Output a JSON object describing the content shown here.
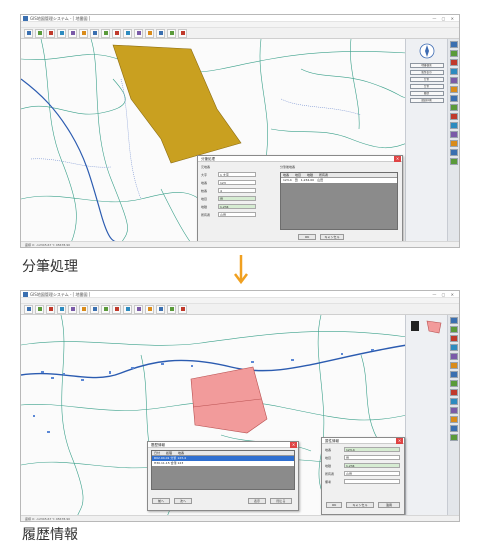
{
  "app": {
    "title": "GIS地図管理システム - [ 地番図 ]",
    "window_controls": "— ▢ ✕",
    "menu": [
      "ファイル",
      "編集",
      "表示",
      "検索",
      "地番",
      "図形",
      "属性",
      "印刷",
      "ツール",
      "設定",
      "ウィンドウ",
      "ヘルプ"
    ],
    "toolbar_icons": [
      "open-icon",
      "save-icon",
      "print-icon",
      "zoom-in-icon",
      "zoom-out-icon",
      "pan-icon",
      "select-icon",
      "measure-icon",
      "layer-icon",
      "search-icon",
      "undo-icon",
      "redo-icon",
      "info-icon",
      "draw-icon",
      "help-icon"
    ]
  },
  "steps": [
    {
      "caption": "分筆処理",
      "parcel_color": "#c9a020",
      "statusbar": "座標 X: -12345.67  Y: 45678.90",
      "dialog": {
        "title": "分筆処理",
        "left_label": "元地番",
        "right_label": "分筆後地番",
        "fields": [
          {
            "label": "大字",
            "value": "1 大字"
          },
          {
            "label": "地番",
            "value": "123"
          },
          {
            "label": "枝番",
            "value": "4"
          },
          {
            "label": "地目",
            "value": "田"
          },
          {
            "label": "地積",
            "value": "1,234"
          },
          {
            "label": "所有者",
            "value": "山田"
          }
        ],
        "grid_header": "地番　　地目　　地積　　所有者",
        "grid_row": "123-4　田　1,234.00　山田",
        "buttons": [
          "OK",
          "キャンセル"
        ]
      },
      "panel_buttons": [
        "地番検索",
        "属性表示",
        "分筆",
        "合筆",
        "履歴",
        "図面印刷"
      ]
    },
    {
      "caption": "履歴情報",
      "parcel_color": "#f29b9b",
      "statusbar": "座標 X: -12345.67  Y: 45678.90",
      "dialog": {
        "title": "履歴情報",
        "grid_header": "日付　　処理　　地番",
        "grid_rows": [
          "R02.04.01 分筆 123-4",
          "H30.11.15 合筆 123"
        ],
        "buttons": [
          "前へ",
          "次へ",
          "表示",
          "閉じる"
        ]
      },
      "attr_dialog": {
        "title": "属性情報",
        "fields": [
          {
            "label": "地番",
            "value": "123-4"
          },
          {
            "label": "地目",
            "value": "田"
          },
          {
            "label": "地積",
            "value": "1,234"
          },
          {
            "label": "所有者",
            "value": "山田"
          },
          {
            "label": "備考",
            "value": ""
          }
        ],
        "buttons": [
          "OK",
          "キャンセル",
          "適用"
        ]
      }
    }
  ]
}
